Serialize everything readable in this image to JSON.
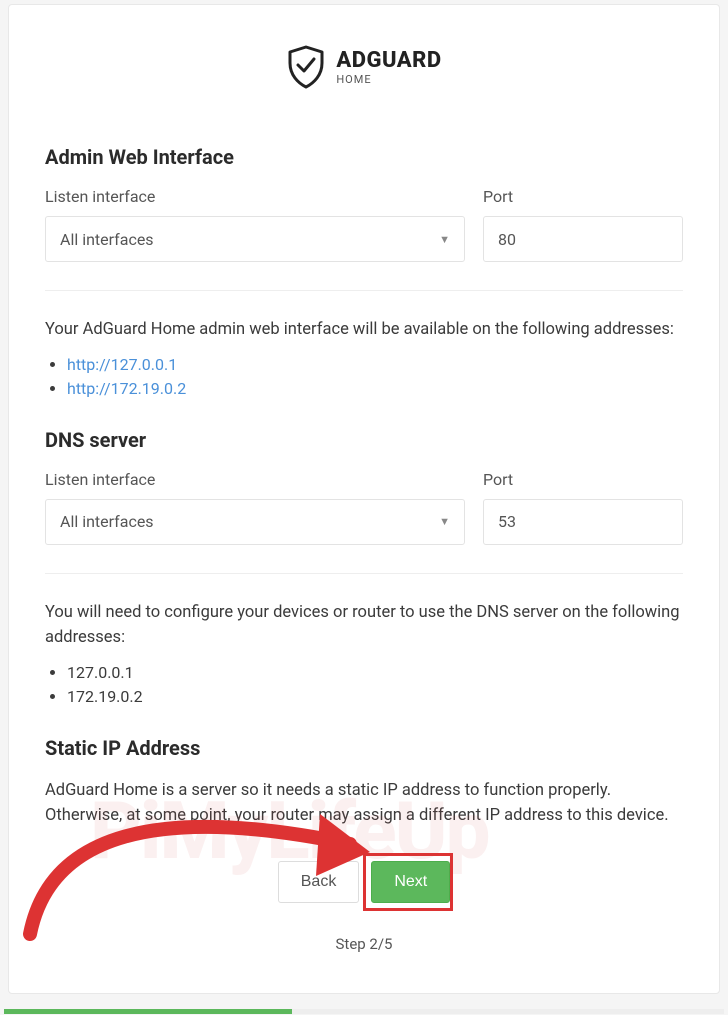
{
  "brand": {
    "title": "ADGUARD",
    "subtitle": "HOME"
  },
  "sections": {
    "admin": {
      "heading": "Admin Web Interface",
      "listen_label": "Listen interface",
      "listen_value": "All interfaces",
      "port_label": "Port",
      "port_value": "80",
      "info": "Your AdGuard Home admin web interface will be available on the following addresses:",
      "addresses": [
        "http://127.0.0.1",
        "http://172.19.0.2"
      ]
    },
    "dns": {
      "heading": "DNS server",
      "listen_label": "Listen interface",
      "listen_value": "All interfaces",
      "port_label": "Port",
      "port_value": "53",
      "info": "You will need to configure your devices or router to use the DNS server on the following addresses:",
      "addresses": [
        "127.0.0.1",
        "172.19.0.2"
      ]
    },
    "static": {
      "heading": "Static IP Address",
      "info": "AdGuard Home is a server so it needs a static IP address to function properly. Otherwise, at some point, your router may assign a different IP address to this device."
    }
  },
  "buttons": {
    "back": "Back",
    "next": "Next"
  },
  "step": "Step 2/5",
  "watermark": "PiMyLifeUp"
}
